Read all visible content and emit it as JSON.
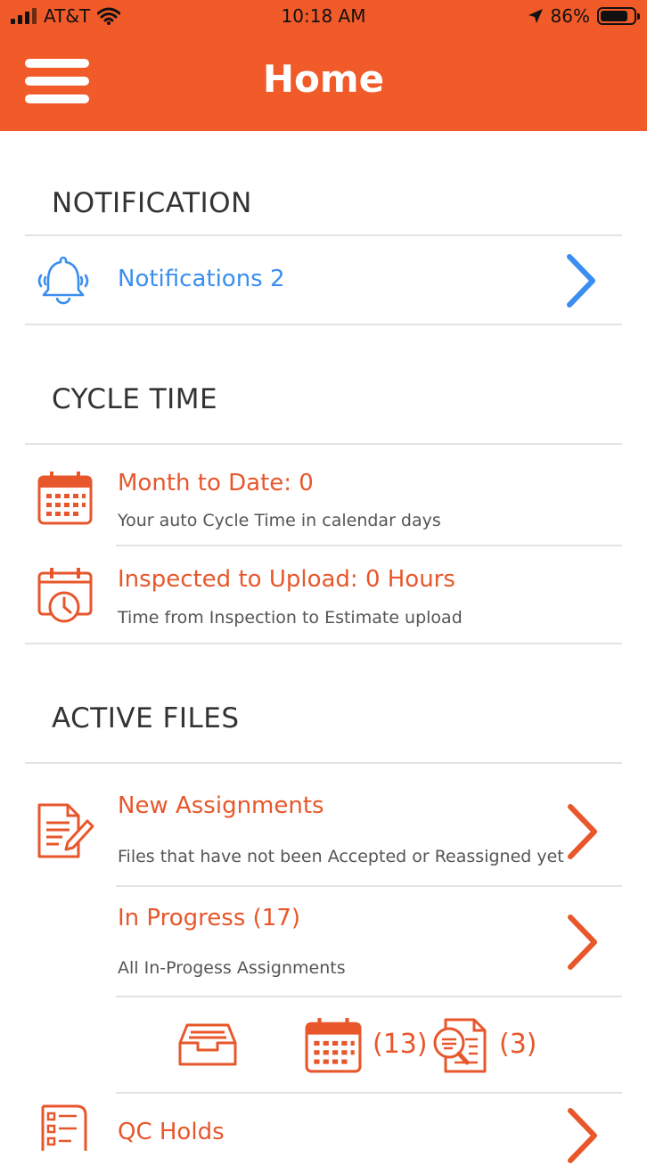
{
  "status_bar": {
    "carrier": "AT&T",
    "time": "10:18 AM",
    "battery": "86%",
    "battery_level": 0.86
  },
  "header": {
    "title": "Home"
  },
  "notification_section": {
    "heading": "NOTIFICATION",
    "item": {
      "label": "Notifications 2",
      "icon": "bell-icon"
    }
  },
  "cycle_time_section": {
    "heading": "CYCLE TIME",
    "items": [
      {
        "title": "Month to Date: 0",
        "subtitle": "Your auto Cycle Time in calendar days",
        "icon": "calendar-icon"
      },
      {
        "title": "Inspected to Upload: 0 Hours",
        "subtitle": "Time from Inspection to Estimate upload",
        "icon": "calendar-clock-icon"
      }
    ]
  },
  "active_files_section": {
    "heading": "ACTIVE FILES",
    "items": [
      {
        "title": "New Assignments",
        "subtitle": "Files that have not been Accepted or Reassigned yet",
        "icon": "document-edit-icon"
      },
      {
        "title": "In Progress (17)",
        "subtitle": "All In-Progess Assignments"
      },
      {
        "title": "QC Holds",
        "icon": "checklist-icon"
      }
    ],
    "quick_filters": [
      {
        "icon": "inbox-tray-icon",
        "count": ""
      },
      {
        "icon": "calendar-icon",
        "count": "(13)"
      },
      {
        "icon": "document-search-icon",
        "count": "(3)"
      }
    ]
  },
  "colors": {
    "brand": "#f15a29",
    "accent_text": "#e8572b",
    "link_blue": "#3a8ef0"
  }
}
